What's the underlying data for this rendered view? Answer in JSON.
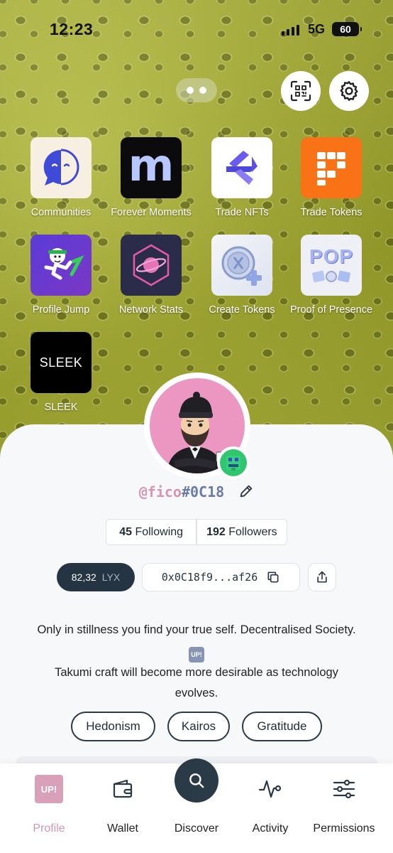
{
  "status_bar": {
    "time": "12:23",
    "network": "5G",
    "battery": "60"
  },
  "apps": [
    {
      "label": "Communities"
    },
    {
      "label": "Forever Moments",
      "tile_text": "m"
    },
    {
      "label": "Trade NFTs"
    },
    {
      "label": "Trade Tokens"
    },
    {
      "label": "Profile Jump"
    },
    {
      "label": "Network Stats"
    },
    {
      "label": "Create Tokens"
    },
    {
      "label": "Proof of Presence",
      "tile_text": "POP"
    },
    {
      "label": "SLEEK",
      "tile_text": "SLEEK"
    }
  ],
  "profile": {
    "handle_name": "@fico",
    "handle_hash": "#0C18",
    "following_count": "45",
    "following_label": "Following",
    "followers_count": "192",
    "followers_label": "Followers",
    "balance_value": "82,32",
    "balance_unit": "LYX",
    "address": "0x0C18f9...af26",
    "bio_line1": "Only in stillness you find your true self. Decentralised Society.",
    "bio_badge": "UP!",
    "bio_line2": "Takumi craft will become more desirable as technology",
    "bio_line3": "evolves.",
    "tags": [
      "Hedonism",
      "Kairos",
      "Gratitude"
    ]
  },
  "nav": {
    "profile_badge": "UP!",
    "items": [
      "Profile",
      "Wallet",
      "Discover",
      "Activity",
      "Permissions"
    ],
    "active": "Profile"
  },
  "colors": {
    "accent": "#d595b0",
    "dark": "#243442",
    "background_green": "#a7ad3a"
  }
}
